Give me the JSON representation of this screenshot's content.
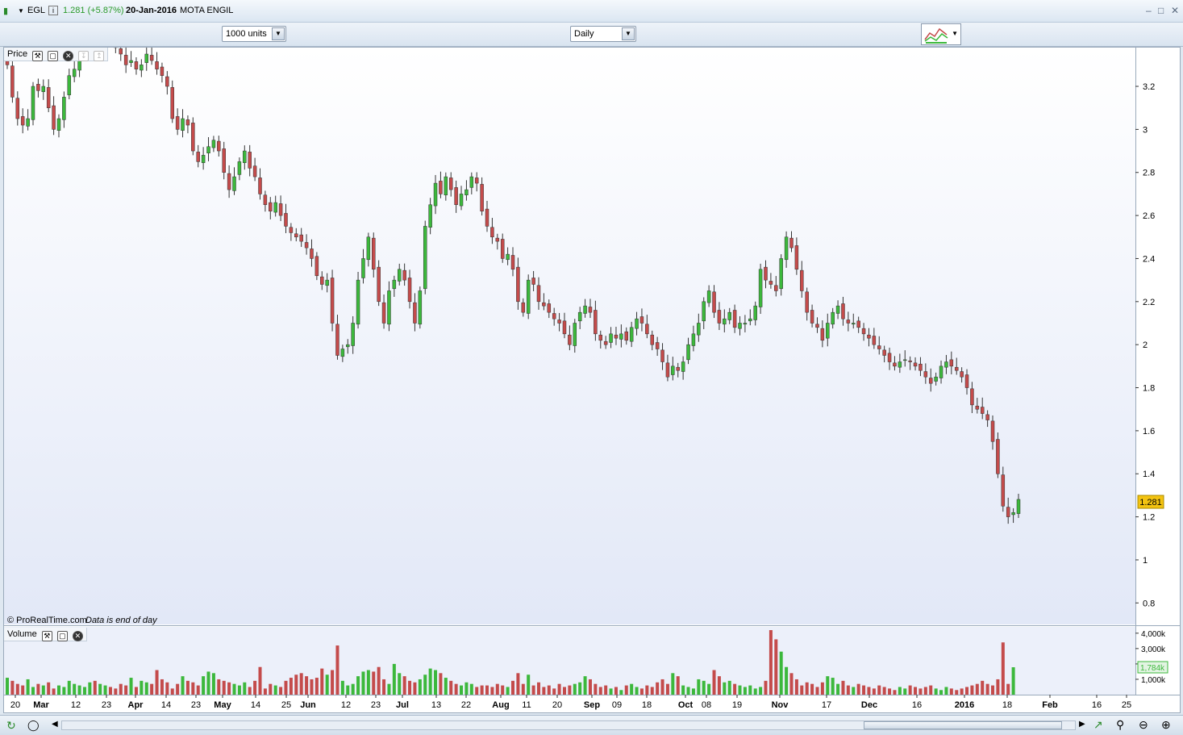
{
  "header": {
    "ticker": "EGL",
    "info_icon": "info-icon",
    "price_change": "1.281 (+5.87%)",
    "date": "20-Jan-2016",
    "company": "MOTA ENGIL"
  },
  "toolbar": {
    "units": "1000 units",
    "period": "Daily"
  },
  "panels": {
    "price_label": "Price",
    "volume_label": "Volume",
    "copyright": "© ProRealTime.com",
    "data_note": "Data is end of day",
    "last_price": "1.281",
    "last_volume": "1,784k"
  },
  "colors": {
    "up": "#3cb83c",
    "down": "#c44b4b",
    "last_price_bg": "#f3c311",
    "last_volume_bg": "#e2f4e2"
  },
  "chart_data": {
    "type": "candlestick",
    "x_ticks": [
      "20",
      "Mar",
      "12",
      "23",
      "Apr",
      "14",
      "23",
      "May",
      "14",
      "25",
      "Jun",
      "12",
      "23",
      "Jul",
      "13",
      "22",
      "Aug",
      "11",
      "20",
      "Sep",
      "09",
      "18",
      "Oct",
      "08",
      "19",
      "Nov",
      "17",
      "Dec",
      "16",
      "2016",
      "18",
      "Feb",
      "16",
      "25"
    ],
    "price_ticks": [
      0.8,
      1,
      1.2,
      1.4,
      1.6,
      1.8,
      2,
      2.2,
      2.4,
      2.6,
      2.8,
      3,
      3.2
    ],
    "price_ylim": [
      0.7,
      3.38
    ],
    "volume_ticks": [
      "1,000k",
      "2,000k",
      "3,000k",
      "4,000k"
    ],
    "volume_ylim": [
      0,
      4200000
    ],
    "close_series": [
      3.3,
      3.15,
      3.05,
      3.02,
      3.05,
      3.2,
      3.18,
      3.2,
      3.1,
      3.0,
      3.05,
      3.15,
      3.25,
      3.28,
      3.35,
      3.4,
      3.42,
      3.38,
      3.4,
      3.45,
      3.42,
      3.38,
      3.35,
      3.3,
      3.32,
      3.28,
      3.3,
      3.35,
      3.32,
      3.28,
      3.25,
      3.2,
      3.05,
      3.0,
      3.05,
      3.02,
      2.9,
      2.85,
      2.88,
      2.92,
      2.95,
      2.9,
      2.8,
      2.72,
      2.78,
      2.85,
      2.9,
      2.82,
      2.78,
      2.7,
      2.65,
      2.62,
      2.66,
      2.6,
      2.55,
      2.52,
      2.5,
      2.48,
      2.45,
      2.4,
      2.32,
      2.28,
      2.3,
      2.1,
      1.95,
      1.98,
      2.0,
      2.1,
      2.3,
      2.4,
      2.5,
      2.35,
      2.2,
      2.1,
      2.25,
      2.3,
      2.35,
      2.3,
      2.2,
      2.1,
      2.25,
      2.55,
      2.65,
      2.75,
      2.7,
      2.78,
      2.72,
      2.65,
      2.7,
      2.72,
      2.78,
      2.75,
      2.62,
      2.55,
      2.5,
      2.48,
      2.4,
      2.42,
      2.35,
      2.2,
      2.15,
      2.3,
      2.28,
      2.2,
      2.18,
      2.15,
      2.12,
      2.1,
      2.05,
      2.0,
      2.1,
      2.15,
      2.18,
      2.15,
      2.05,
      2.02,
      2.0,
      2.05,
      2.03,
      2.05,
      2.02,
      2.08,
      2.12,
      2.1,
      2.05,
      2.0,
      1.98,
      1.92,
      1.85,
      1.9,
      1.88,
      1.92,
      2.0,
      2.05,
      2.1,
      2.2,
      2.25,
      2.15,
      2.1,
      2.12,
      2.15,
      2.08,
      2.1,
      2.1,
      2.12,
      2.18,
      2.35,
      2.3,
      2.28,
      2.25,
      2.4,
      2.5,
      2.45,
      2.35,
      2.25,
      2.15,
      2.1,
      2.08,
      2.02,
      2.1,
      2.15,
      2.18,
      2.12,
      2.1,
      2.1,
      2.08,
      2.05,
      2.03,
      2.0,
      1.98,
      1.95,
      1.92,
      1.9,
      1.92,
      1.93,
      1.92,
      1.9,
      1.88,
      1.85,
      1.82,
      1.85,
      1.9,
      1.92,
      1.9,
      1.88,
      1.85,
      1.8,
      1.72,
      1.7,
      1.68,
      1.65,
      1.55,
      1.4,
      1.25,
      1.2,
      1.22,
      1.281
    ],
    "volume_series": [
      1100000,
      900000,
      700000,
      600000,
      1000000,
      500000,
      700000,
      600000,
      800000,
      400000,
      600000,
      500000,
      900000,
      700000,
      600000,
      500000,
      800000,
      900000,
      700000,
      600000,
      500000,
      400000,
      700000,
      600000,
      1100000,
      500000,
      900000,
      800000,
      700000,
      1600000,
      1000000,
      800000,
      400000,
      700000,
      1200000,
      900000,
      800000,
      600000,
      1200000,
      1500000,
      1400000,
      1000000,
      900000,
      800000,
      700000,
      600000,
      800000,
      500000,
      900000,
      1800000,
      400000,
      700000,
      600000,
      500000,
      900000,
      1100000,
      1300000,
      1400000,
      1200000,
      1000000,
      1100000,
      1700000,
      1300000,
      1600000,
      3200000,
      900000,
      600000,
      700000,
      1200000,
      1500000,
      1600000,
      1500000,
      1800000,
      1000000,
      700000,
      2000000,
      1400000,
      1200000,
      900000,
      800000,
      1000000,
      1300000,
      1700000,
      1600000,
      1400000,
      1100000,
      900000,
      700000,
      600000,
      800000,
      700000,
      500000,
      600000,
      600000,
      500000,
      700000,
      600000,
      500000,
      900000,
      1400000,
      700000,
      1300000,
      600000,
      800000,
      500000,
      600000,
      400000,
      700000,
      500000,
      600000,
      700000,
      800000,
      1200000,
      1000000,
      700000,
      500000,
      600000,
      400000,
      500000,
      300000,
      600000,
      700000,
      500000,
      400000,
      600000,
      500000,
      800000,
      1000000,
      700000,
      1400000,
      1200000,
      600000,
      500000,
      400000,
      1000000,
      900000,
      700000,
      1600000,
      1200000,
      800000,
      900000,
      700000,
      600000,
      500000,
      600000,
      400000,
      500000,
      900000,
      4200000,
      3600000,
      2800000,
      1800000,
      1400000,
      1000000,
      600000,
      800000,
      700000,
      500000,
      800000,
      1200000,
      1100000,
      700000,
      900000,
      600000,
      500000,
      700000,
      600000,
      500000,
      400000,
      600000,
      500000,
      400000,
      300000,
      500000,
      400000,
      600000,
      500000,
      400000,
      500000,
      600000,
      400000,
      300000,
      500000,
      400000,
      300000,
      400000,
      500000,
      600000,
      700000,
      900000,
      700000,
      600000,
      1000000,
      3400000,
      700000,
      1784000
    ]
  }
}
